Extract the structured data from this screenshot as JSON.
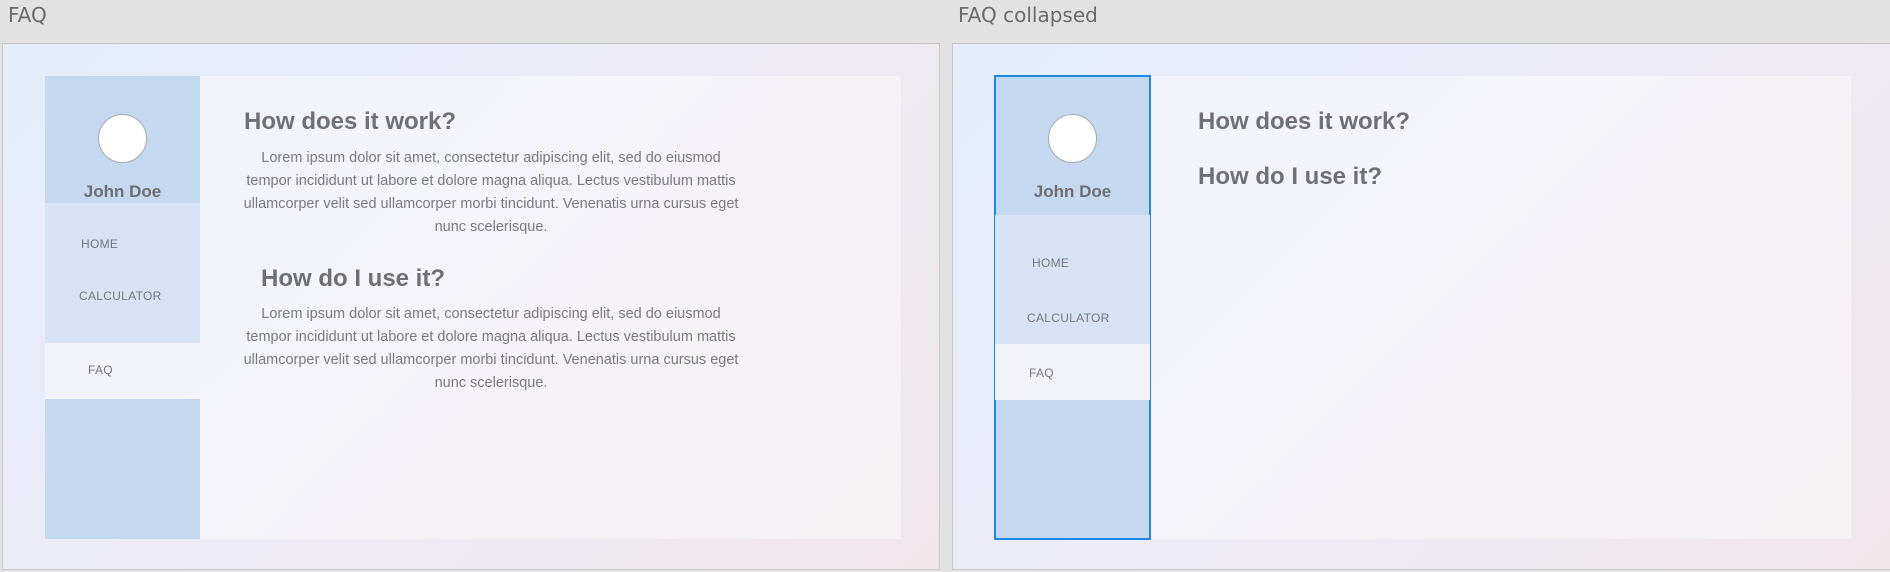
{
  "boards": {
    "expanded": {
      "title": "FAQ"
    },
    "collapsed": {
      "title": "FAQ collapsed"
    }
  },
  "user": {
    "name": "John Doe"
  },
  "nav": {
    "home": "HOME",
    "calculator": "CALCULATOR",
    "faq": "FAQ"
  },
  "faq": {
    "q1": "How does it work?",
    "a1": "Lorem ipsum dolor sit amet, consectetur adipiscing elit, sed do eiusmod tempor incididunt ut labore et dolore magna aliqua.  Lectus vestibulum mattis ullamcorper velit sed ullamcorper morbi tincidunt. Venenatis urna cursus eget nunc scelerisque.",
    "q2": "How do I use it?",
    "a2": "Lorem ipsum dolor sit amet, consectetur adipiscing elit, sed do eiusmod tempor incididunt ut labore et dolore magna aliqua.  Lectus vestibulum mattis ullamcorper velit sed ullamcorper morbi tincidunt. Venenatis urna cursus eget nunc scelerisque."
  },
  "colors": {
    "canvas": "#e2e2e2",
    "sidebar": "#c4d8ef",
    "nav_panel": "#d6e3f4",
    "nav_active": "#f2f3fa",
    "selection": "#1e88e5"
  }
}
